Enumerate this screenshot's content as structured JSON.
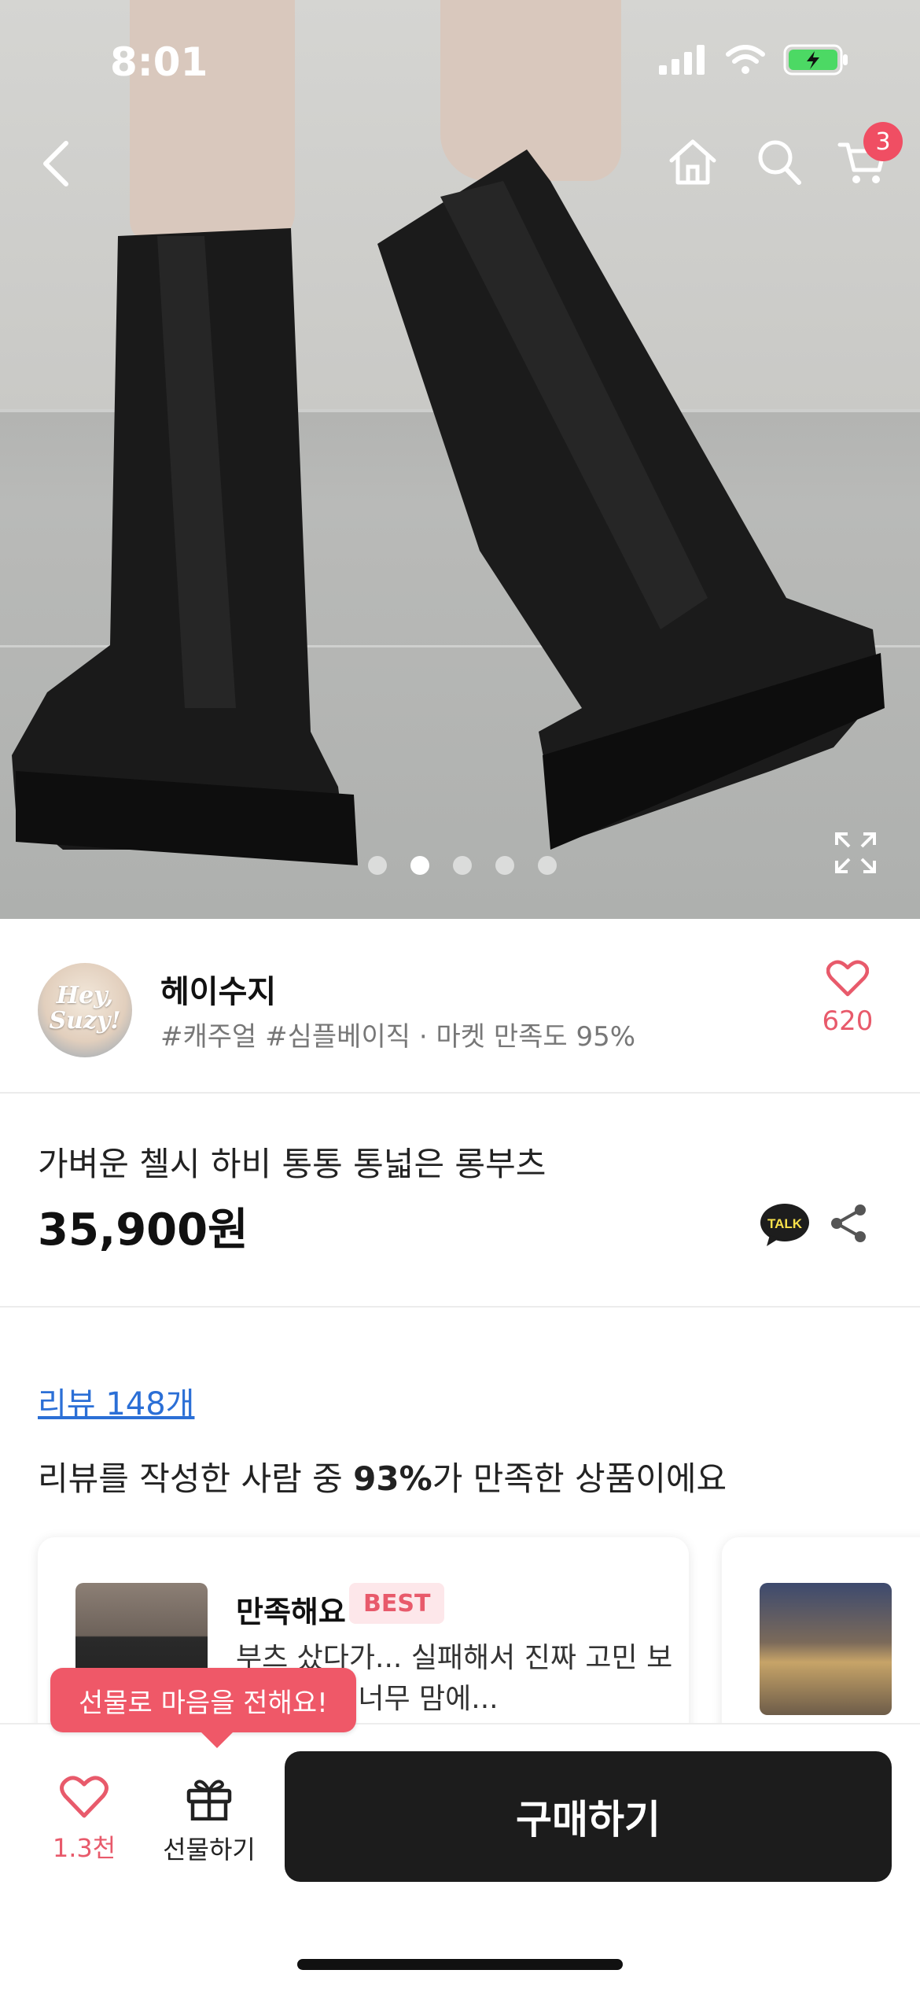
{
  "status_bar": {
    "time": "8:01"
  },
  "nav": {
    "cart_count": "3"
  },
  "carousel": {
    "total": 5,
    "active_index": 1
  },
  "store": {
    "avatar_text": "Hey, Suzy!",
    "name": "헤이수지",
    "tags": "#캐주얼 #심플베이직 · 마켓 만족도 95%",
    "like_count": "620"
  },
  "product": {
    "title": "가벼운 첼시 하비 통통 통넓은 롱부츠",
    "price": "35,900원",
    "talk_label": "TALK"
  },
  "reviews": {
    "link_label": "리뷰 148개",
    "summary_prefix": "리뷰를 작성한 사람 중 ",
    "summary_percent": "93%",
    "summary_suffix": "가 만족한 상품이에요",
    "items": [
      {
        "title": "만족해요",
        "badge": "BEST",
        "text": "부츠 샀다가... 실패해서 진짜 고민 보고 샀는데 너무 맘에..."
      }
    ]
  },
  "bottom_bar": {
    "tooltip": "선물로 마음을 전해요!",
    "like_count": "1.3천",
    "gift_label": "선물하기",
    "buy_label": "구매하기"
  },
  "colors": {
    "accent": "#e85a6b",
    "link": "#2b6fd6",
    "buy_button": "#1c1c1c"
  }
}
